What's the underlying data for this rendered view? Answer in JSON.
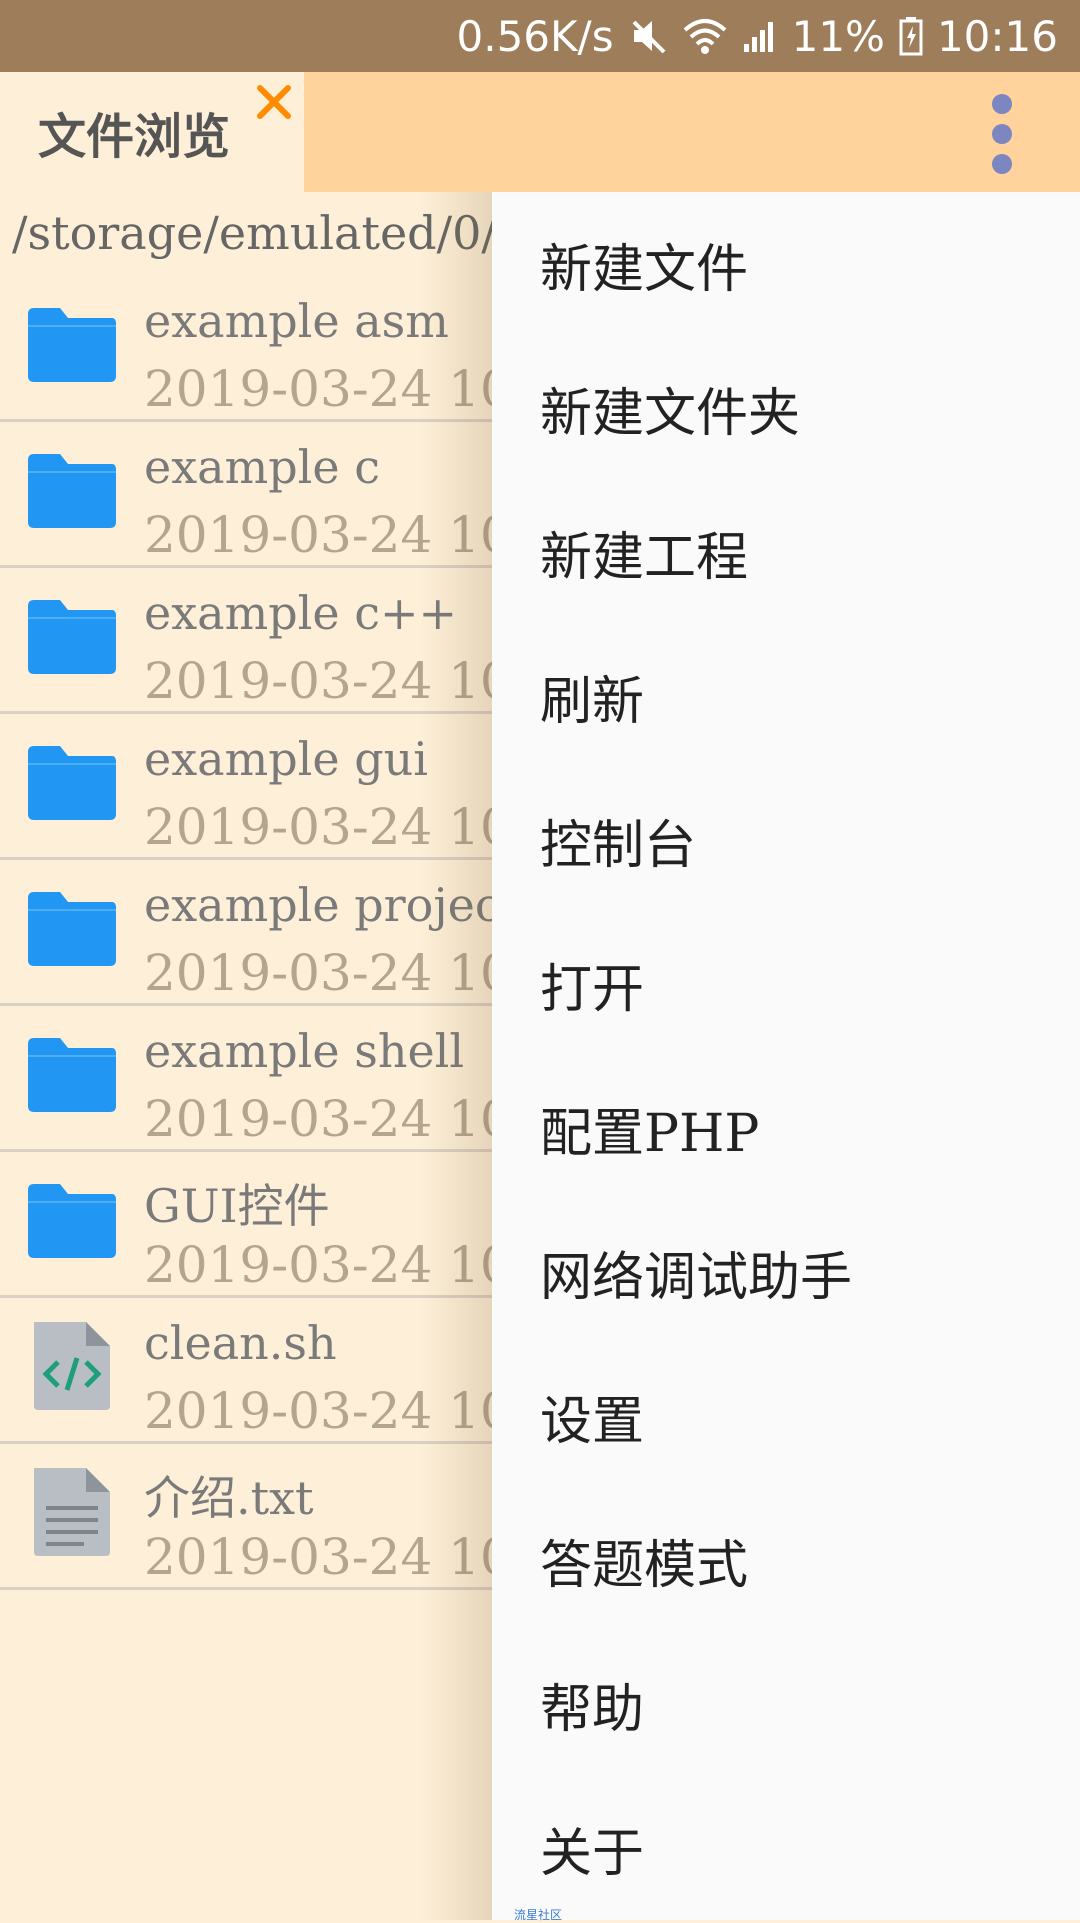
{
  "status_bar": {
    "network_speed": "0.56K/s",
    "battery": "11%",
    "time": "10:16",
    "icons": [
      "mute-icon",
      "wifi-icon",
      "signal-icon",
      "battery-icon"
    ]
  },
  "tabs": [
    {
      "label": "文件浏览",
      "close_icon": "close-icon"
    }
  ],
  "colors": {
    "accent": "#FF8C00",
    "folder": "#2196F3",
    "app_bar": "#FFD39B",
    "background": "#FEF0D8"
  },
  "path": "/storage/emulated/0/",
  "files": [
    {
      "name": "example asm",
      "date": "2019-03-24 10",
      "icon": "folder-icon"
    },
    {
      "name": "example c",
      "date": "2019-03-24 10",
      "icon": "folder-icon"
    },
    {
      "name": "example c++",
      "date": "2019-03-24 10",
      "icon": "folder-icon"
    },
    {
      "name": "example gui",
      "date": "2019-03-24 10",
      "icon": "folder-icon"
    },
    {
      "name": "example projec",
      "date": "2019-03-24 10",
      "icon": "folder-icon"
    },
    {
      "name": "example shell",
      "date": "2019-03-24 10",
      "icon": "folder-icon"
    },
    {
      "name": "GUI控件",
      "date": "2019-03-24 10",
      "icon": "folder-icon"
    },
    {
      "name": "clean.sh",
      "date": "2019-03-24 10",
      "icon": "code-file-icon"
    },
    {
      "name": "介绍.txt",
      "date": "2019-03-24 10",
      "icon": "text-file-icon"
    }
  ],
  "menu": {
    "items": [
      {
        "label": "新建文件"
      },
      {
        "label": "新建文件夹"
      },
      {
        "label": "新建工程"
      },
      {
        "label": "刷新"
      },
      {
        "label": "控制台"
      },
      {
        "label": "打开"
      },
      {
        "label": "配置PHP"
      },
      {
        "label": "网络调试助手"
      },
      {
        "label": "设置"
      },
      {
        "label": "答题模式"
      },
      {
        "label": "帮助"
      },
      {
        "label": "关于"
      }
    ]
  },
  "watermark": "流星社区"
}
